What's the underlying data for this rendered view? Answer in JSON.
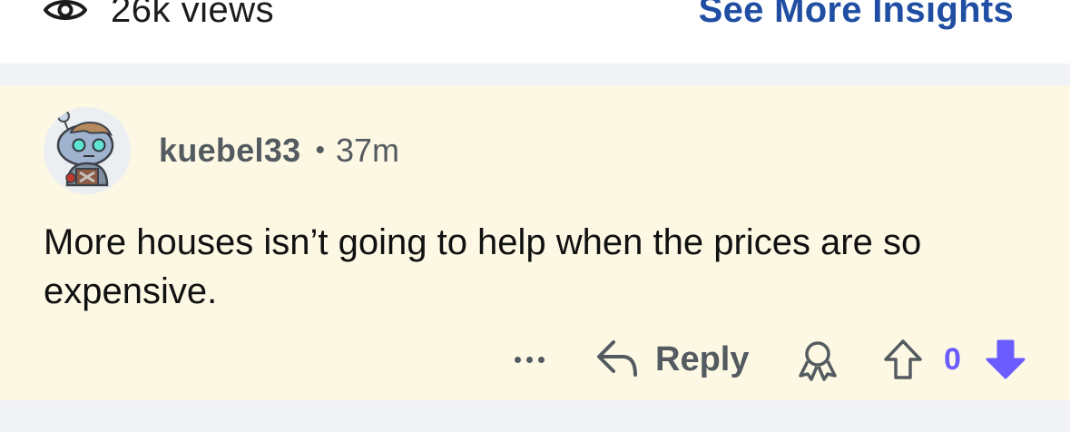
{
  "stats": {
    "views_label": "26k views",
    "see_more_insights": "See More Insights",
    "icon": "eye-icon"
  },
  "comment": {
    "username": "kuebel33",
    "separator": "•",
    "timestamp": "37m",
    "body": "More houses isn’t going to help when the prices are so expensive.",
    "actions": {
      "more_icon": "more-dots-icon",
      "reply_label": "Reply",
      "reply_icon": "reply-arrow-icon",
      "award_icon": "award-icon",
      "upvote_icon": "upvote-arrow-icon",
      "score": "0",
      "downvote_icon": "downvote-arrow-icon"
    }
  },
  "colors": {
    "comment_background": "#fdf8e4",
    "separator": "#f1f2f5",
    "link": "#1f4ea3",
    "vote_accent": "#6a5cff",
    "meta_text": "#545b60"
  }
}
